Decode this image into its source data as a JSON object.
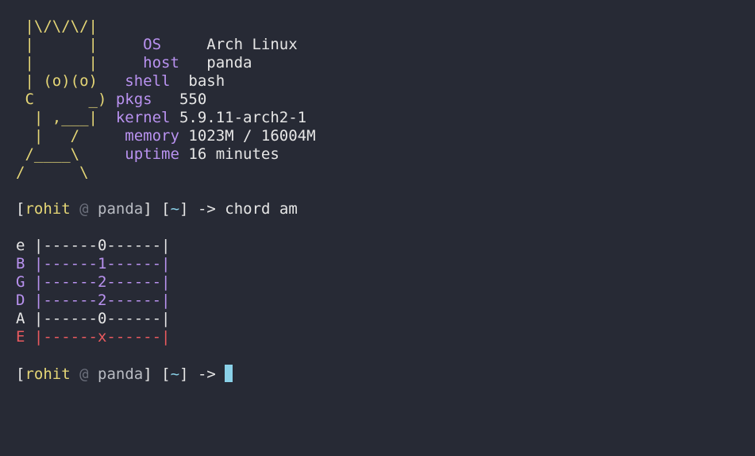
{
  "ascii_art": [
    " |\\/\\/\\/|",
    " |      |",
    " |      |",
    " | (o)(o)",
    " C      _)",
    "  | ,___|",
    "  |   /",
    " /____\\",
    "/      \\"
  ],
  "sysinfo": [
    {
      "label": "OS",
      "value": "Arch Linux"
    },
    {
      "label": "host",
      "value": "panda"
    },
    {
      "label": "shell",
      "value": "bash"
    },
    {
      "label": "pkgs",
      "value": "550"
    },
    {
      "label": "kernel",
      "value": "5.9.11-arch2-1"
    },
    {
      "label": "memory",
      "value": "1023M / 16004M"
    },
    {
      "label": "uptime",
      "value": "16 minutes"
    }
  ],
  "prompt": {
    "open_bracket": "[",
    "user": "rohit",
    "at": "@",
    "host": "panda",
    "close_bracket": "]",
    "dir_open": "[",
    "dir": "~",
    "dir_close": "]",
    "arrow": "->"
  },
  "command": "chord am",
  "chord_rows": [
    {
      "string": "e",
      "tab": "|------0------|"
    },
    {
      "string": "B",
      "tab": "|------1------|"
    },
    {
      "string": "G",
      "tab": "|------2------|"
    },
    {
      "string": "D",
      "tab": "|------2------|"
    },
    {
      "string": "A",
      "tab": "|------0------|"
    },
    {
      "string": "E",
      "tab": "|------x------|"
    }
  ],
  "colors": {
    "background": "#272a35",
    "yellow": "#e5d676",
    "purple": "#b992f0",
    "red": "#ea5a5f",
    "cyan": "#8ad1e8"
  }
}
